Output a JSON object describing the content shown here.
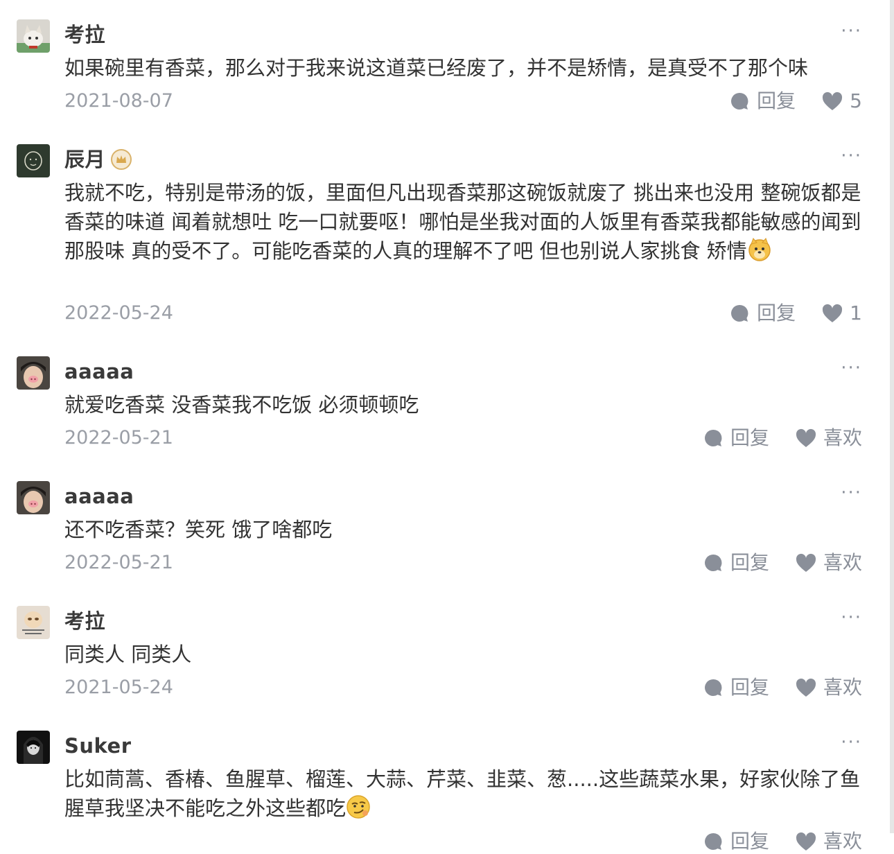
{
  "comments": [
    {
      "user": "考拉",
      "text": "如果碗里有香菜，那么对于我来说这道菜已经废了，并不是矫情，是真受不了那个味",
      "date": "2021-08-07",
      "reply": "回复",
      "like": "5"
    },
    {
      "user": "辰月",
      "badge": "crown-badge-icon",
      "text": "我就不吃，特别是带汤的饭，里面但凡出现香菜那这碗饭就废了 挑出来也没用 整碗饭都是香菜的味道 闻着就想吐 吃一口就要呕！哪怕是坐我对面的人饭里有香菜我都能敏感的闻到那股味 真的受不了。可能吃香菜的人真的理解不了吧 但也别说人家挑食 矫情",
      "emoji": "dog-emoji-icon",
      "date": "2022-05-24",
      "reply": "回复",
      "like": "1"
    },
    {
      "user": "aaaaa",
      "text": "就爱吃香菜 没香菜我不吃饭 必须顿顿吃",
      "date": "2022-05-21",
      "reply": "回复",
      "like": "喜欢"
    },
    {
      "user": "aaaaa",
      "text": "还不吃香菜？笑死 饿了啥都吃",
      "date": "2022-05-21",
      "reply": "回复",
      "like": "喜欢"
    },
    {
      "user": "考拉",
      "text": "同类人 同类人",
      "date": "2021-05-24",
      "reply": "回复",
      "like": "喜欢"
    },
    {
      "user": "Suker",
      "text": "比如茼蒿、香椿、鱼腥草、榴莲、大蒜、芹菜、韭菜、葱.....这些蔬菜水果，好家伙除了鱼腥草我坚决不能吃之外这些都吃",
      "emoji": "smirk-emoji-icon",
      "date": "",
      "reply": "回复",
      "like": "喜欢"
    }
  ],
  "more_label": "···",
  "colors": {
    "text": "#333333",
    "meta": "#9a9ea6",
    "icon": "#8a8f99"
  }
}
